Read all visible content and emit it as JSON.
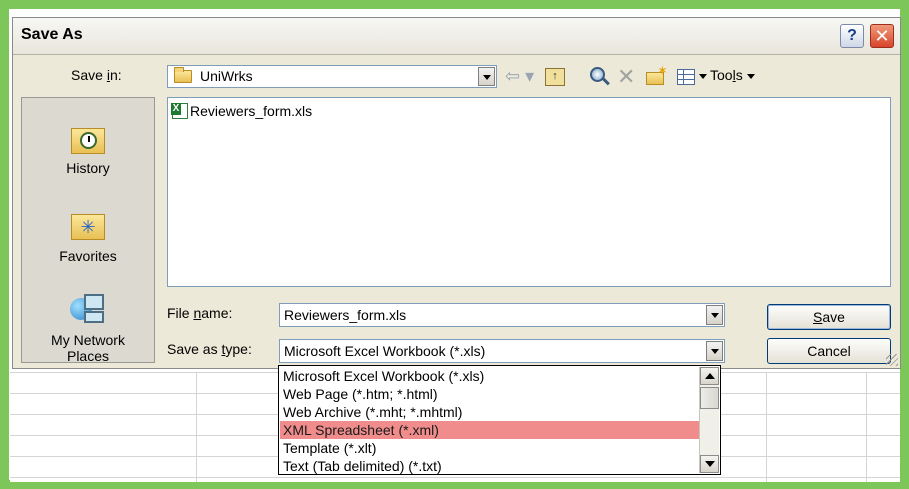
{
  "dialog": {
    "title": "Save As",
    "help_glyph": "?",
    "close_glyph": "✕"
  },
  "save_in": {
    "label_prefix": "Save ",
    "label_accel": "i",
    "label_suffix": "n:",
    "value": "UniWrks"
  },
  "toolbar": {
    "back_glyph": "⇦ ▾",
    "up_glyph": "↑",
    "delete_glyph": "✕",
    "tools_prefix": "Too",
    "tools_accel": "l",
    "tools_suffix": "s"
  },
  "places": [
    {
      "label": "History",
      "icon": "history-icon"
    },
    {
      "label": "Favorites",
      "icon": "favorites-icon"
    },
    {
      "label_line1": "My Network",
      "label_line2": "Places",
      "icon": "network-places-icon"
    }
  ],
  "files": [
    {
      "name": "Reviewers_form.xls",
      "icon": "excel-file-icon"
    }
  ],
  "file_name": {
    "label_prefix": "File ",
    "label_accel": "n",
    "label_suffix": "ame:",
    "value": "Reviewers_form.xls"
  },
  "save_as_type": {
    "label_prefix": "Save as ",
    "label_accel": "t",
    "label_suffix": "ype:",
    "value": "Microsoft Excel Workbook (*.xls)",
    "options": [
      "Microsoft Excel Workbook (*.xls)",
      "Web Page (*.htm; *.html)",
      "Web Archive (*.mht; *.mhtml)",
      "XML Spreadsheet (*.xml)",
      "Template (*.xlt)",
      "Text (Tab delimited) (*.txt)"
    ],
    "selected_index": 3,
    "highlight_color": "#f08c8c"
  },
  "buttons": {
    "save_accel": "S",
    "save_rest": "ave",
    "cancel": "Cancel"
  },
  "colors": {
    "frame_green": "#7dc65a",
    "dialog_face": "#ece9d8"
  }
}
